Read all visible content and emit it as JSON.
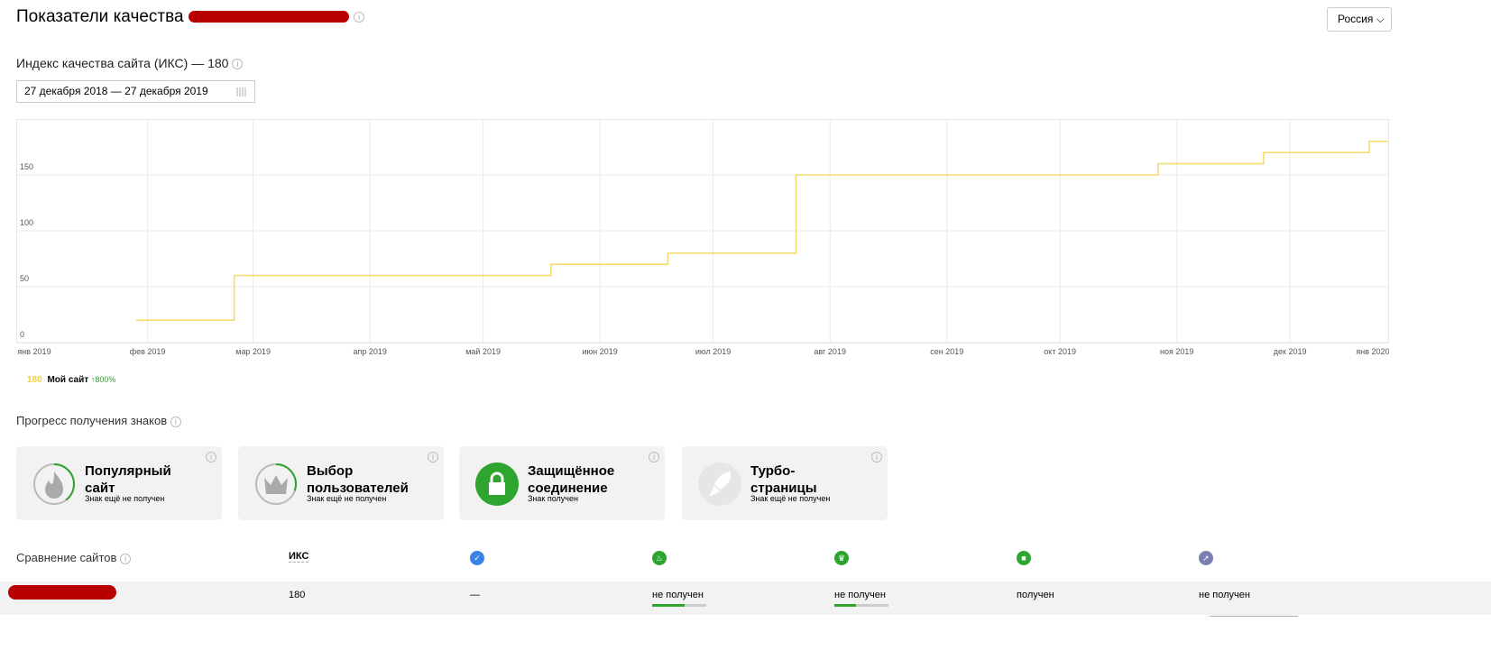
{
  "header": {
    "title": "Показатели качества",
    "region": "Россия"
  },
  "iks": {
    "label": "Индекс качества сайта (ИКС) — 180",
    "date_range": "27 декабря 2018 — 27 декабря 2019"
  },
  "chart_data": {
    "type": "line",
    "title": "ИКС",
    "x_unit": "days since 1 Jan 2019",
    "xlim": [
      -5,
      361
    ],
    "ylim": [
      0,
      200
    ],
    "y_ticks": [
      0,
      50,
      100,
      150
    ],
    "x_ticks": [
      {
        "day": 0,
        "label": "янв 2019"
      },
      {
        "day": 31,
        "label": "фев 2019"
      },
      {
        "day": 59,
        "label": "мар 2019"
      },
      {
        "day": 90,
        "label": "апр 2019"
      },
      {
        "day": 120,
        "label": "май 2019"
      },
      {
        "day": 151,
        "label": "июн 2019"
      },
      {
        "day": 181,
        "label": "июл 2019"
      },
      {
        "day": 212,
        "label": "авг 2019"
      },
      {
        "day": 243,
        "label": "сен 2019"
      },
      {
        "day": 273,
        "label": "окт 2019"
      },
      {
        "day": 304,
        "label": "ноя 2019"
      },
      {
        "day": 334,
        "label": "дек 2019"
      },
      {
        "day": 356,
        "label": "янв 2020"
      }
    ],
    "series": [
      {
        "name": "Мой сайт",
        "color": "#f5dc6e",
        "step": true,
        "points": [
          [
            28,
            20
          ],
          [
            54,
            20
          ],
          [
            54,
            60
          ],
          [
            138,
            60
          ],
          [
            138,
            70
          ],
          [
            169,
            70
          ],
          [
            169,
            80
          ],
          [
            203,
            80
          ],
          [
            203,
            150
          ],
          [
            299,
            150
          ],
          [
            299,
            160
          ],
          [
            327,
            160
          ],
          [
            327,
            170
          ],
          [
            355,
            170
          ],
          [
            355,
            180
          ],
          [
            360,
            180
          ]
        ]
      }
    ],
    "legend": {
      "value": "180",
      "name": "Мой сайт",
      "change": "↑800%"
    }
  },
  "badges": {
    "title": "Прогресс получения знаков",
    "items": [
      {
        "name": "Популярный сайт",
        "status": "Знак ещё не получен",
        "progress": 0.4
      },
      {
        "name": "Выбор пользователей",
        "status": "Знак ещё не получен",
        "progress": 0.3
      },
      {
        "name": "Защищённое соединение",
        "status": "Знак получен",
        "progress": 1
      },
      {
        "name": "Турбо-страницы",
        "status": "Знак ещё не получен",
        "progress": 0
      }
    ]
  },
  "compare": {
    "title": "Сравнение сайтов",
    "iks_header": "ИКС",
    "row": {
      "iks": "180",
      "verified": "—",
      "popular": "не получен",
      "popular_progress": 0.6,
      "choice": "не получен",
      "choice_progress": 0.4,
      "secure": "получен",
      "turbo": "не получен"
    }
  }
}
